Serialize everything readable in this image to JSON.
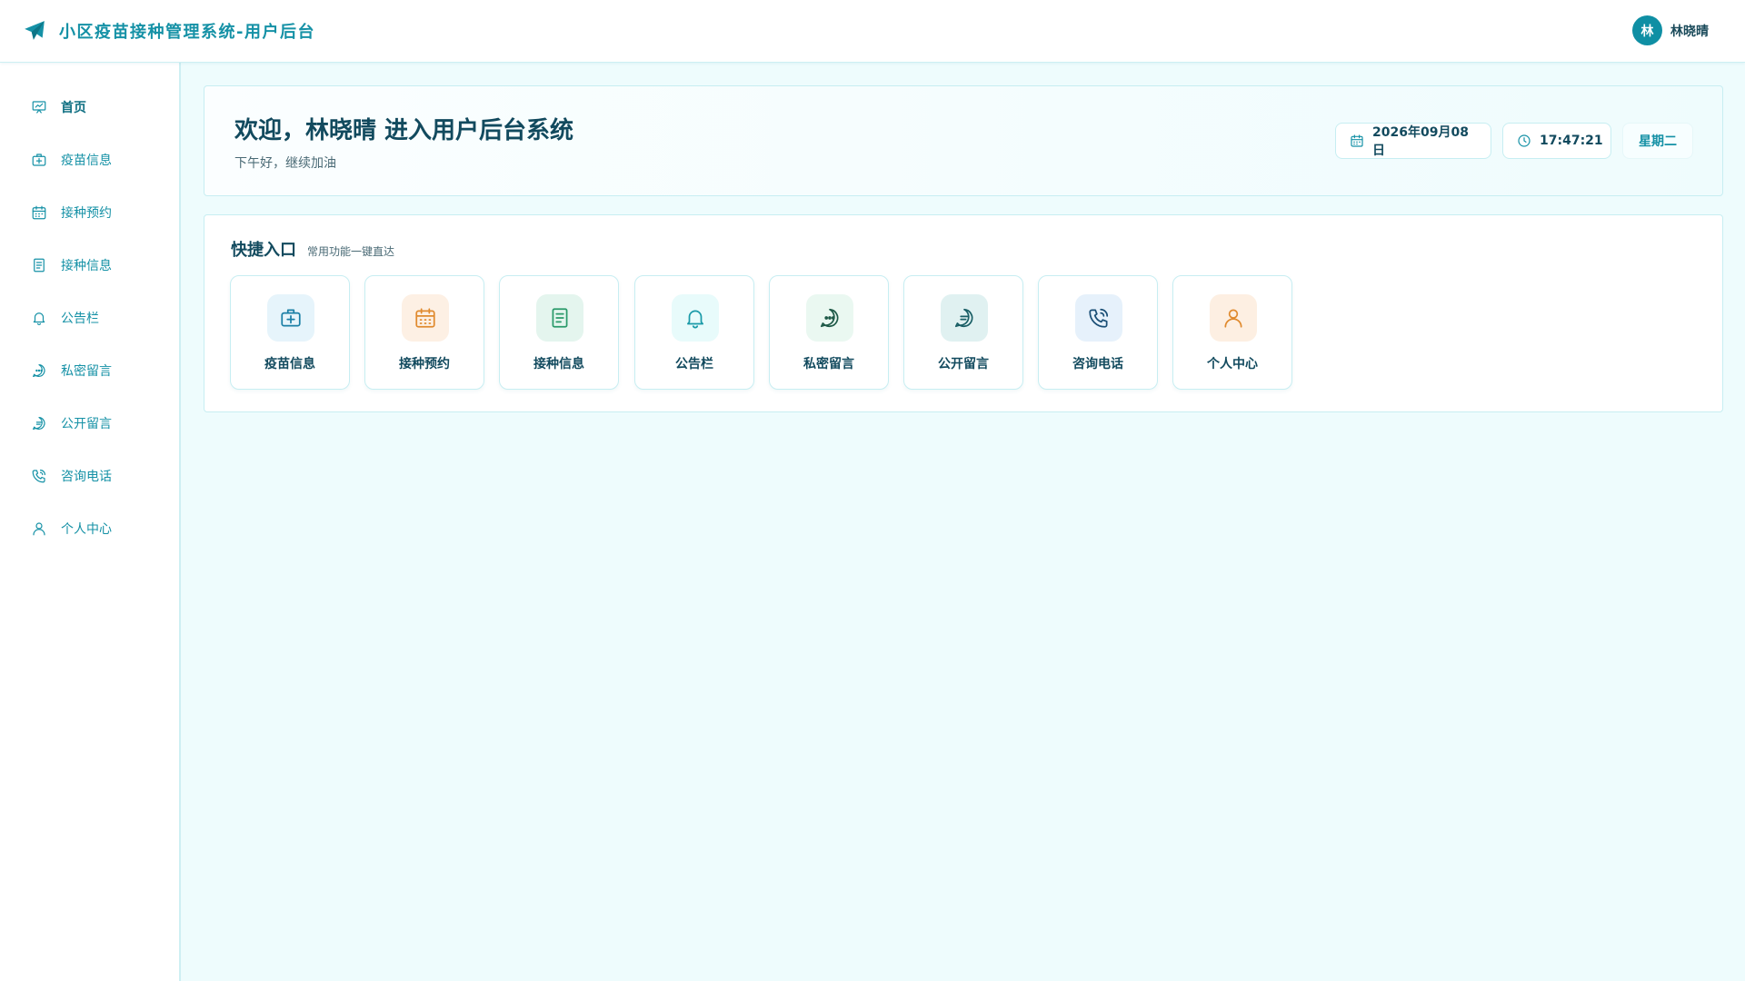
{
  "app": {
    "title": "小区疫苗接种管理系统-用户后台"
  },
  "user": {
    "avatar_initial": "林",
    "name": "林晓晴"
  },
  "sidebar": {
    "items": [
      {
        "label": "首页",
        "icon": "home-chart-icon",
        "active": true
      },
      {
        "label": "疫苗信息",
        "icon": "medical-kit-icon",
        "active": false
      },
      {
        "label": "接种预约",
        "icon": "calendar-icon",
        "active": false
      },
      {
        "label": "接种信息",
        "icon": "document-icon",
        "active": false
      },
      {
        "label": "公告栏",
        "icon": "bell-icon",
        "active": false
      },
      {
        "label": "私密留言",
        "icon": "chat-dots-icon",
        "active": false
      },
      {
        "label": "公开留言",
        "icon": "chat-lines-icon",
        "active": false
      },
      {
        "label": "咨询电话",
        "icon": "phone-icon",
        "active": false
      },
      {
        "label": "个人中心",
        "icon": "user-icon",
        "active": false
      }
    ]
  },
  "welcome": {
    "title": "欢迎，林晓晴 进入用户后台系统",
    "subtitle": "下午好，继续加油",
    "date": "2026年09月08日",
    "time": "17:47:21",
    "weekday": "星期二"
  },
  "quick": {
    "title": "快捷入口",
    "subtitle": "常用功能一键直达",
    "tiles": [
      {
        "label": "疫苗信息",
        "icon": "medical-kit-icon",
        "bg": "#e6f4fb",
        "color": "#1b7fa6"
      },
      {
        "label": "接种预约",
        "icon": "calendar-icon",
        "bg": "#fdf0e4",
        "color": "#e08a2e"
      },
      {
        "label": "接种信息",
        "icon": "document-icon",
        "bg": "#e4f5ee",
        "color": "#2a9a6a"
      },
      {
        "label": "公告栏",
        "icon": "bell-icon",
        "bg": "#e8fbfb",
        "color": "#1a9aa8"
      },
      {
        "label": "私密留言",
        "icon": "chat-dots-icon",
        "bg": "#eaf8f1",
        "color": "#1f8a5a"
      },
      {
        "label": "公开留言",
        "icon": "chat-lines-icon",
        "bg": "#e0f1f1",
        "color": "#1a7f86"
      },
      {
        "label": "咨询电话",
        "icon": "phone-icon",
        "bg": "#e6f1fb",
        "color": "#1b6fa6"
      },
      {
        "label": "个人中心",
        "icon": "user-icon",
        "bg": "#fdefe2",
        "color": "#e08a2e"
      }
    ]
  },
  "colors": {
    "accent": "#1591a6",
    "page_bg": "#eefcfd",
    "border": "#c7eef2"
  }
}
